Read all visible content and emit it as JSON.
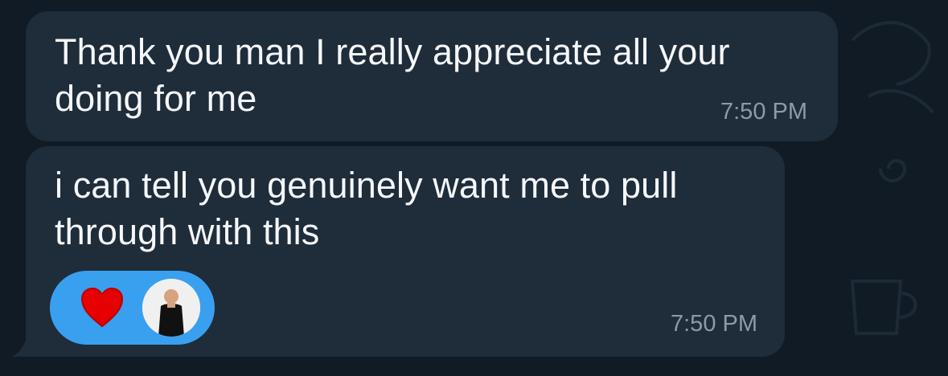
{
  "messages": [
    {
      "text": "Thank you man I really appreciate all your\ndoing for me",
      "time": "7:50 PM"
    },
    {
      "text": "i can tell you genuinely want me to pull\nthrough with this",
      "time": "7:50 PM",
      "reaction": {
        "emoji_icon": "heart-icon",
        "avatar_icon": "user-avatar"
      }
    }
  ],
  "colors": {
    "background": "#101b25",
    "bubble": "#1f2c3a",
    "text": "#f5f7fa",
    "timestamp": "#8c9aab",
    "reaction": "#39a0f0",
    "heart": "#e60000"
  }
}
